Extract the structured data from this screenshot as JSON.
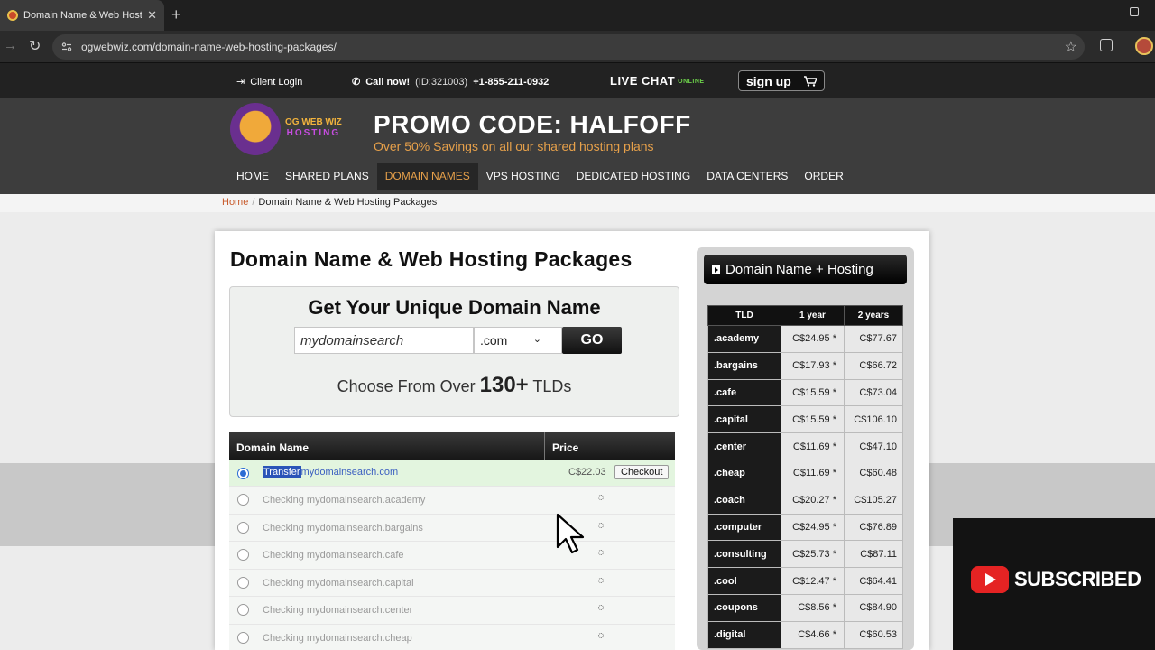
{
  "browser": {
    "tab_title": "Domain Name & Web Hosting",
    "url": "ogwebwiz.com/domain-name-web-hosting-packages/"
  },
  "topbar": {
    "client_login": "Client Login",
    "call_now": "Call now!",
    "call_id": "(ID:321003)",
    "phone": "+1-855-211-0932",
    "live_chat": "LIVE CHAT",
    "online": "ONLINE",
    "signup": "sign up"
  },
  "header": {
    "logo_line1": "OG WEB WIZ",
    "logo_line2": "HOSTING",
    "promo_title": "PROMO CODE: HALFOFF",
    "promo_sub": "Over 50% Savings on all our shared hosting plans",
    "nav": [
      "HOME",
      "SHARED PLANS",
      "DOMAIN NAMES",
      "VPS HOSTING",
      "DEDICATED HOSTING",
      "DATA CENTERS",
      "ORDER"
    ],
    "active_nav": "DOMAIN NAMES"
  },
  "breadcrumb": {
    "home": "Home",
    "separator": "/",
    "current": "Domain Name & Web Hosting Packages"
  },
  "main": {
    "page_title": "Domain Name & Web Hosting Packages",
    "search_heading": "Get Your Unique Domain Name",
    "search_value": "mydomainsearch",
    "tld_selected": ".com",
    "go_label": "GO",
    "choose_prefix": "Choose From Over",
    "choose_count": "130+",
    "choose_suffix": "TLDs",
    "results_headers": {
      "name": "Domain Name",
      "price": "Price"
    },
    "first_row": {
      "action": "Transfer",
      "domain": "mydomainsearch.com",
      "price": "C$22.03",
      "checkout": "Checkout"
    },
    "checking_rows": [
      "Checking mydomainsearch.academy",
      "Checking mydomainsearch.bargains",
      "Checking mydomainsearch.cafe",
      "Checking mydomainsearch.capital",
      "Checking mydomainsearch.center",
      "Checking mydomainsearch.cheap"
    ]
  },
  "sidebar": {
    "title": "Domain Name + Hosting",
    "headers": [
      "TLD",
      "1 year",
      "2 years"
    ],
    "rows": [
      {
        "tld": ".academy",
        "y1": "C$24.95 *",
        "y2": "C$77.67"
      },
      {
        "tld": ".bargains",
        "y1": "C$17.93 *",
        "y2": "C$66.72"
      },
      {
        "tld": ".cafe",
        "y1": "C$15.59 *",
        "y2": "C$73.04"
      },
      {
        "tld": ".capital",
        "y1": "C$15.59 *",
        "y2": "C$106.10"
      },
      {
        "tld": ".center",
        "y1": "C$11.69 *",
        "y2": "C$47.10"
      },
      {
        "tld": ".cheap",
        "y1": "C$11.69 *",
        "y2": "C$60.48"
      },
      {
        "tld": ".coach",
        "y1": "C$20.27 *",
        "y2": "C$105.27"
      },
      {
        "tld": ".computer",
        "y1": "C$24.95 *",
        "y2": "C$76.89"
      },
      {
        "tld": ".consulting",
        "y1": "C$25.73 *",
        "y2": "C$87.11"
      },
      {
        "tld": ".cool",
        "y1": "C$12.47 *",
        "y2": "C$64.41"
      },
      {
        "tld": ".coupons",
        "y1": "C$8.56 *",
        "y2": "C$84.90"
      },
      {
        "tld": ".digital",
        "y1": "C$4.66 *",
        "y2": "C$60.53"
      }
    ]
  },
  "overlay": {
    "subscribed": "SUBSCRIBED"
  },
  "colors": {
    "accent": "#e6a04a",
    "link": "#3b5fc0",
    "online": "#6cd04a",
    "youtube": "#e52323"
  }
}
